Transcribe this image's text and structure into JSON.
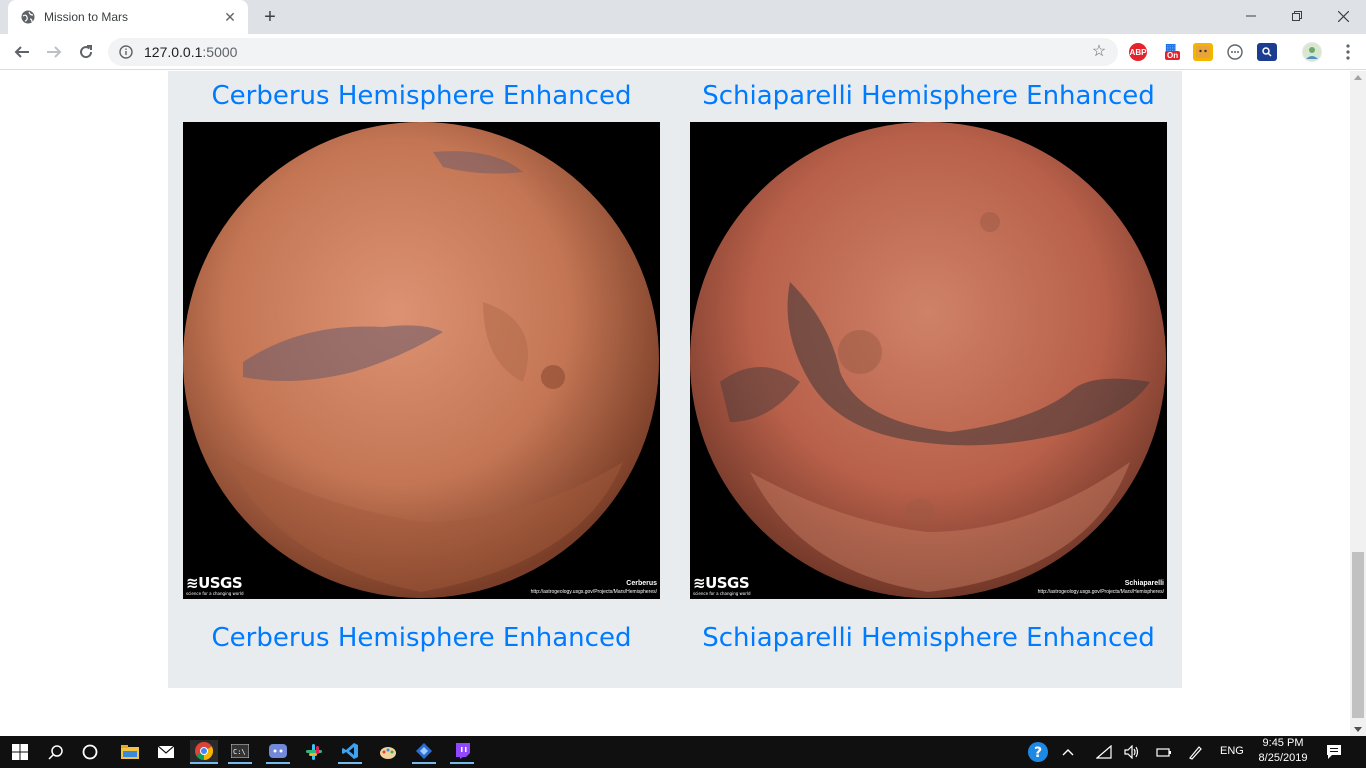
{
  "browser": {
    "tab_title": "Mission to Mars",
    "url_host": "127.0.0.1",
    "url_port": ":5000",
    "extensions": {
      "abp": "ABP",
      "on_badge": "On"
    }
  },
  "hemispheres": {
    "top_row": [
      {
        "title": "Cerberus Hemisphere Enhanced"
      },
      {
        "title": "Schiaparelli Hemisphere Enhanced"
      }
    ],
    "images": [
      {
        "logo": "USGS",
        "tagline": "science for a changing world",
        "name": "Cerberus",
        "link": "http://astrogeology.usgs.gov/Projects/Mars/Hemispheres/",
        "planet_color": "#c47654"
      },
      {
        "logo": "USGS",
        "tagline": "science for a changing world",
        "name": "Schiaparelli",
        "link": "http://astrogeology.usgs.gov/Projects/Mars/Hemispheres/",
        "planet_color": "#b8604a"
      }
    ],
    "bottom_row": [
      {
        "title": "Cerberus Hemisphere Enhanced"
      },
      {
        "title": "Schiaparelli Hemisphere Enhanced"
      }
    ]
  },
  "taskbar": {
    "language": "ENG",
    "time": "9:45 PM",
    "date": "8/25/2019"
  },
  "colors": {
    "link": "#007bff",
    "jumbotron": "#e9ecef",
    "taskbar": "#101010"
  }
}
